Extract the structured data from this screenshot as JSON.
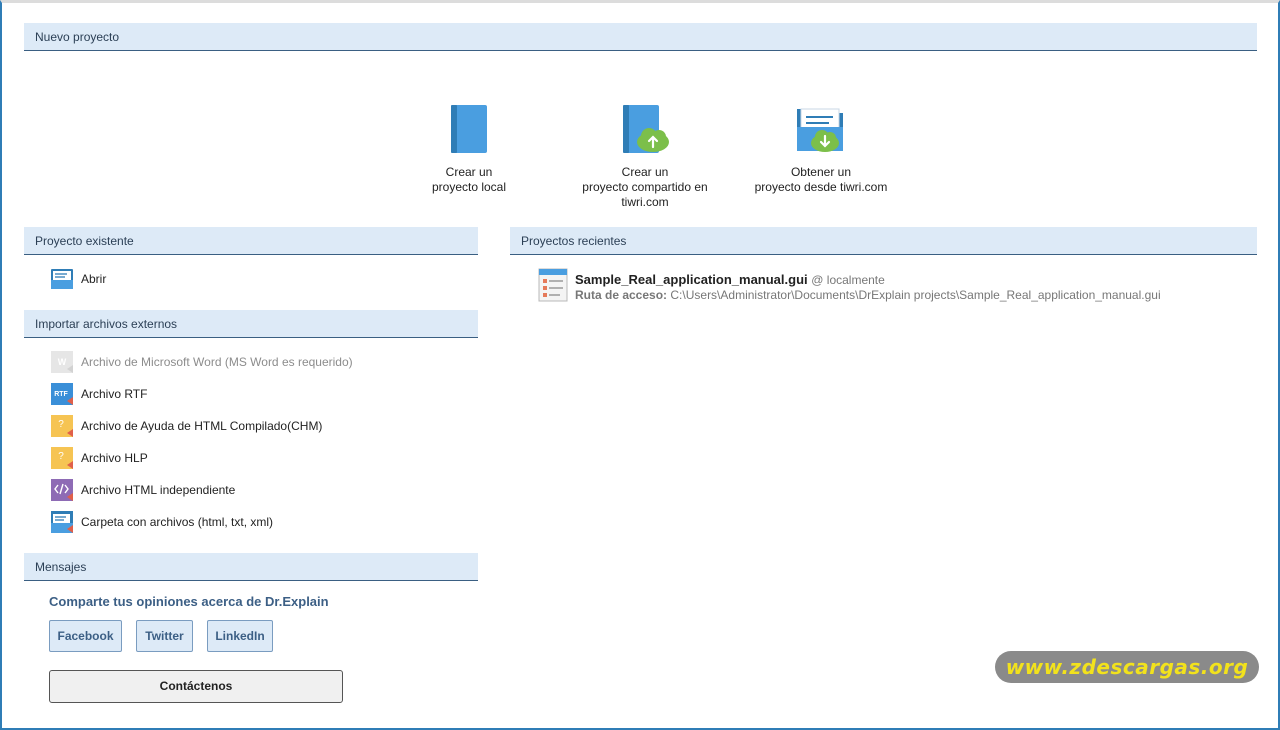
{
  "sections": {
    "new_project": "Nuevo proyecto",
    "existing_project": "Proyecto existente",
    "recent_projects": "Proyectos recientes",
    "import_external": "Importar archivos externos",
    "messages": "Mensajes"
  },
  "new_project_actions": [
    {
      "line1": "Crear un",
      "line2": "proyecto local",
      "line3": "",
      "icon": "book-icon"
    },
    {
      "line1": "Crear un",
      "line2": "proyecto compartido en",
      "line3": "tiwri.com",
      "icon": "book-cloud-upload-icon"
    },
    {
      "line1": "Obtener un",
      "line2": "proyecto desde tiwri.com",
      "line3": "",
      "icon": "folder-cloud-download-icon"
    }
  ],
  "existing": {
    "open_label": "Abrir"
  },
  "recent": {
    "name": "Sample_Real_application_manual.gui",
    "location": "@ localmente",
    "path_label": "Ruta de acceso:",
    "path_value": "C:\\Users\\Administrator\\Documents\\DrExplain projects\\Sample_Real_application_manual.gui"
  },
  "imports": [
    {
      "label": "Archivo de Microsoft Word (MS Word es requerido)",
      "icon": "word-icon",
      "enabled": false
    },
    {
      "label": "Archivo RTF",
      "icon": "rtf-icon",
      "enabled": true
    },
    {
      "label": "Archivo de Ayuda de HTML Compilado(CHM)",
      "icon": "chm-icon",
      "enabled": true
    },
    {
      "label": "Archivo HLP",
      "icon": "hlp-icon",
      "enabled": true
    },
    {
      "label": "Archivo HTML independiente",
      "icon": "html-icon",
      "enabled": true
    },
    {
      "label": "Carpeta con archivos (html, txt, xml)",
      "icon": "folder-files-icon",
      "enabled": true
    }
  ],
  "messages": {
    "share_title": "Comparte tus opiniones acerca de Dr.Explain",
    "facebook": "Facebook",
    "twitter": "Twitter",
    "linkedin": "LinkedIn",
    "contact": "Contáctenos"
  },
  "watermark": "www.zdescargas.org",
  "colors": {
    "header_bg": "#ddeaf7",
    "accent_blue": "#3a8fd8",
    "cloud_green": "#7cbf4a",
    "link_blue": "#3c5f85"
  }
}
